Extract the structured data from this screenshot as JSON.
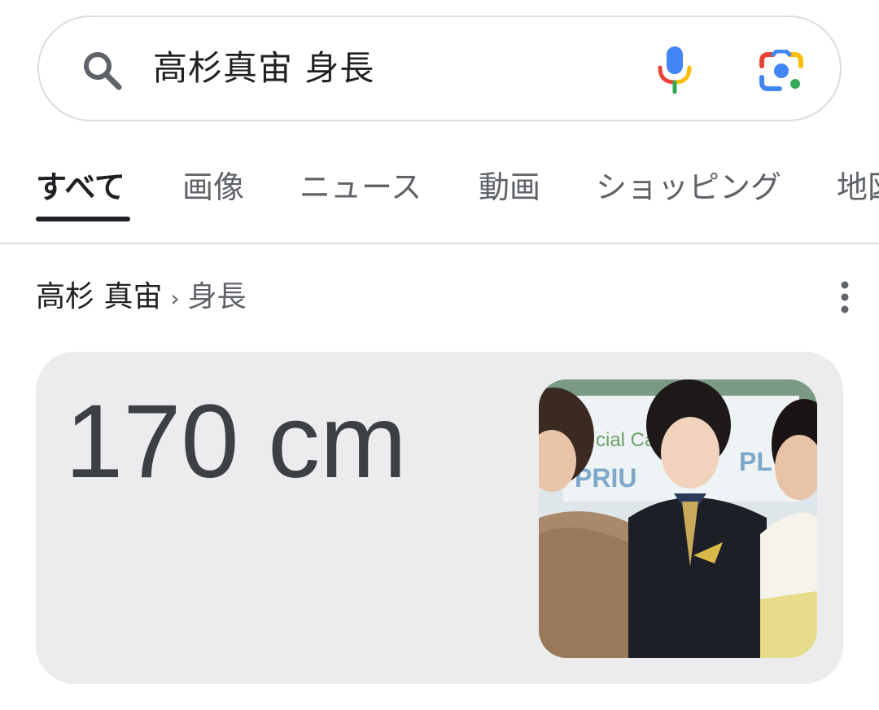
{
  "search": {
    "query": "高杉真宙 身長"
  },
  "tabs": [
    {
      "label": "すべて",
      "active": true
    },
    {
      "label": "画像",
      "active": false
    },
    {
      "label": "ニュース",
      "active": false
    },
    {
      "label": "動画",
      "active": false
    },
    {
      "label": "ショッピング",
      "active": false
    },
    {
      "label": "地図",
      "active": false
    }
  ],
  "result": {
    "breadcrumb_main": "高杉 真宙",
    "breadcrumb_sep": "›",
    "breadcrumb_sub": "身長",
    "answer": "170 cm",
    "photo_sign_text": "Special Ca... PRIUS PH"
  },
  "icons": {
    "search": "search-icon",
    "mic": "microphone-icon",
    "lens": "google-lens-icon",
    "more": "more-vertical-icon"
  },
  "colors": {
    "google_blue": "#4285F4",
    "google_red": "#EA4335",
    "google_yellow": "#FBBC05",
    "google_green": "#34A853"
  }
}
